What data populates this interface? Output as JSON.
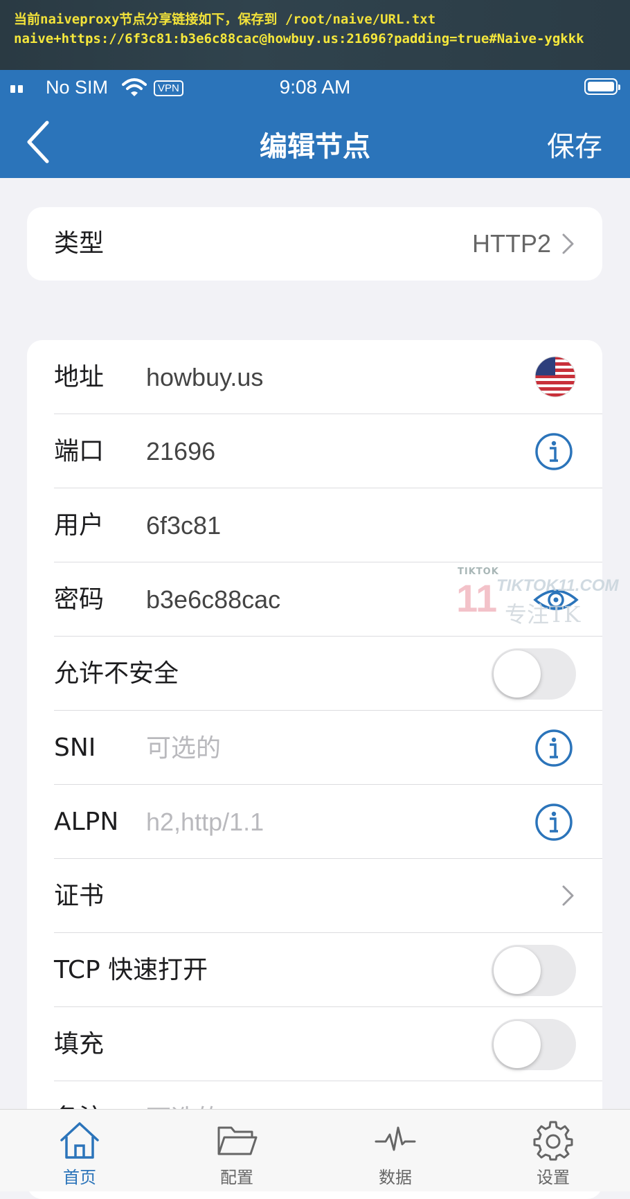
{
  "terminal": {
    "line1": "当前naiveproxy节点分享链接如下，保存到 /root/naive/URL.txt",
    "line2": "naive+https://6f3c81:b3e6c88cac@howbuy.us:21696?padding=true#Naive-ygkkk"
  },
  "status_bar": {
    "carrier": "No SIM",
    "vpn": "VPN",
    "time": "9:08 AM"
  },
  "nav": {
    "title": "编辑节点",
    "save_label": "保存"
  },
  "type_row": {
    "label": "类型",
    "value": "HTTP2"
  },
  "rows": [
    {
      "label": "地址",
      "value": "howbuy.us",
      "placeholder": false,
      "accessory": "us-flag-icon"
    },
    {
      "label": "端口",
      "value": "21696",
      "placeholder": false,
      "accessory": "info-icon"
    },
    {
      "label": "用户",
      "value": "6f3c81",
      "placeholder": false,
      "accessory": ""
    },
    {
      "label": "密码",
      "value": "b3e6c88cac",
      "placeholder": false,
      "accessory": "eye-icon"
    },
    {
      "label": "允许不安全",
      "value": "",
      "placeholder": false,
      "accessory": "toggle-off"
    },
    {
      "label": "SNI",
      "value": "可选的",
      "placeholder": true,
      "accessory": "info-icon"
    },
    {
      "label": "ALPN",
      "value": "h2,http/1.1",
      "placeholder": true,
      "accessory": "info-icon"
    },
    {
      "label": "证书",
      "value": "",
      "placeholder": false,
      "accessory": "chevron-right-icon"
    },
    {
      "label": "TCP 快速打开",
      "value": "",
      "placeholder": false,
      "accessory": "toggle-off"
    },
    {
      "label": "填充",
      "value": "",
      "placeholder": false,
      "accessory": "toggle-off"
    },
    {
      "label": "备注",
      "value": "可选的",
      "placeholder": true,
      "accessory": ""
    }
  ],
  "watermark": {
    "brand": "TIKTOK",
    "number": "11",
    "domain": "TIKTOK11.COM",
    "slogan": "专注TK"
  },
  "tabbar": [
    {
      "label": "首页",
      "icon": "home-icon",
      "active": true
    },
    {
      "label": "配置",
      "icon": "folder-icon",
      "active": false
    },
    {
      "label": "数据",
      "icon": "pulse-icon",
      "active": false
    },
    {
      "label": "设置",
      "icon": "gear-icon",
      "active": false
    }
  ],
  "colors": {
    "accent": "#2b74ba",
    "terminal_text": "#f2e23a",
    "background": "#f2f2f6"
  }
}
